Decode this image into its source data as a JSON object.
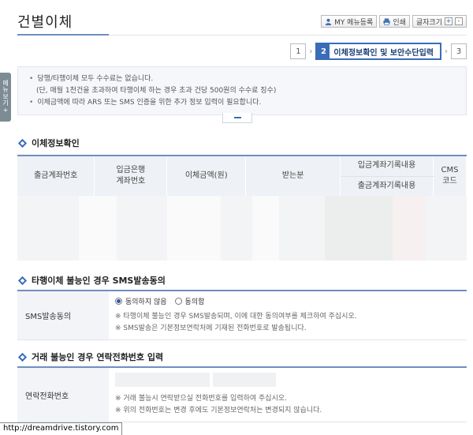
{
  "header": {
    "title": "건별이체",
    "tools": {
      "my_menu": "MY 메뉴등록",
      "print": "인쇄",
      "font_size": "글자크기",
      "font_plus": "+",
      "font_minus": "-"
    }
  },
  "steps": {
    "step1": "1",
    "step2_num": "2",
    "step2_label": "이체정보확인 및 보안수단입력",
    "step3": "3",
    "arrow": "›"
  },
  "side_tab": {
    "chars": [
      "메",
      "뉴",
      "보",
      "기",
      "+"
    ]
  },
  "notice": {
    "line1": "당행/타행이체 모두 수수료는 없습니다.",
    "line2": "(단, 매월 1천건을 초과하여 타행이체 하는 경우 초과 건당 500원의 수수료 징수)",
    "line3": "이체금액에 따라 ARS 또는 SMS 인증을 위한 추가 정보 입력이 필요합니다."
  },
  "transfer_info": {
    "title": "이체정보확인",
    "columns": {
      "out_account": "출금계좌번호",
      "in_bank_l1": "입금은행",
      "in_bank_l2": "계좌번호",
      "amount": "이체금액(원)",
      "receiver": "받는분",
      "in_record": "입금계좌기록내용",
      "out_record": "출금계좌기록내용",
      "cms_l1": "CMS",
      "cms_l2": "코드"
    }
  },
  "sms_section": {
    "title": "타행이체 불능인 경우 SMS발송동의",
    "label": "SMS발송동의",
    "option_disagree": "동의하지 않음",
    "option_agree": "동의함",
    "note1": "※ 타행이체 불능인 경우 SMS발송되며, 이에 대한 동의여부를 체크하여 주십시오.",
    "note2": "※ SMS발송은 기본정보연락처에 기재된 전화번호로 발송됩니다."
  },
  "phone_section": {
    "title": "거래 불능인 경우 연락전화번호 입력",
    "label": "연락전화번호",
    "note1": "※ 거래 불능시 연락받으실 전화번호를 입력하여 주십시오.",
    "note2": "※ 위의 전화번호는 변경 후에도 기본정보연락처는 변경되지 않습니다."
  },
  "watermark": "http://dreamdrive.tistory.com",
  "colors": {
    "accent": "#3a6cb8",
    "header_bg": "#eef1f5"
  }
}
